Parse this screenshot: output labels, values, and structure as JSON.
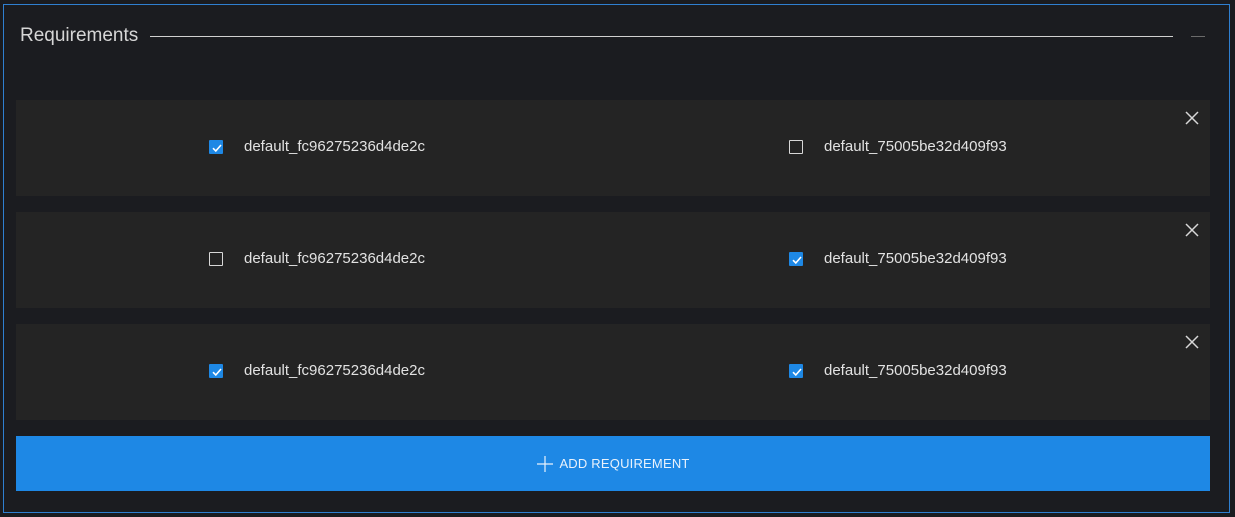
{
  "panel": {
    "title": "Requirements",
    "collapse_icon": "minus-icon"
  },
  "requirements": [
    {
      "options": [
        {
          "label": "default_fc96275236d4de2c",
          "checked": true
        },
        {
          "label": "default_75005be32d409f93",
          "checked": false
        }
      ],
      "remove_icon": "close-icon"
    },
    {
      "options": [
        {
          "label": "default_fc96275236d4de2c",
          "checked": false
        },
        {
          "label": "default_75005be32d409f93",
          "checked": true
        }
      ],
      "remove_icon": "close-icon"
    },
    {
      "options": [
        {
          "label": "default_fc96275236d4de2c",
          "checked": true
        },
        {
          "label": "default_75005be32d409f93",
          "checked": true
        }
      ],
      "remove_icon": "close-icon"
    }
  ],
  "add_button": {
    "label": "ADD REQUIREMENT",
    "icon": "plus-icon"
  },
  "colors": {
    "accent": "#1e88e5",
    "panel_border": "#2f7fd0",
    "background": "#1b1c20",
    "row_background": "#242424"
  }
}
